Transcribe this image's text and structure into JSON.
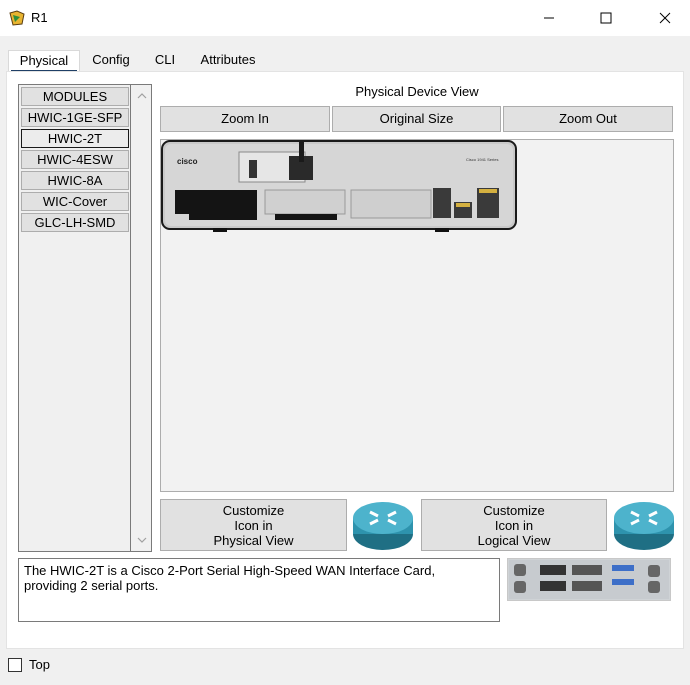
{
  "window": {
    "title": "R1",
    "controls": {
      "minimize": "minimize-icon",
      "maximize": "maximize-icon",
      "close": "close-icon"
    }
  },
  "tabs": [
    {
      "label": "Physical",
      "active": true
    },
    {
      "label": "Config",
      "active": false
    },
    {
      "label": "CLI",
      "active": false
    },
    {
      "label": "Attributes",
      "active": false
    }
  ],
  "modules": {
    "items": [
      "MODULES",
      "HWIC-1GE-SFP",
      "HWIC-2T",
      "HWIC-4ESW",
      "HWIC-8A",
      "WIC-Cover",
      "GLC-LH-SMD"
    ],
    "selected": "HWIC-2T"
  },
  "device_view": {
    "label": "Physical Device View",
    "zoom_in": "Zoom In",
    "original_size": "Original Size",
    "zoom_out": "Zoom Out",
    "brand": "cisco",
    "model": "Cisco 1941 Series"
  },
  "customize": {
    "physical": [
      "Customize",
      "Icon in",
      "Physical View"
    ],
    "logical": [
      "Customize",
      "Icon in",
      "Logical View"
    ]
  },
  "description": {
    "line1": "The HWIC-2T is a Cisco 2-Port Serial High-Speed WAN Interface Card,",
    "line2": "providing 2 serial ports."
  },
  "footer": {
    "top_label": "Top",
    "top_checked": false
  },
  "colors": {
    "accent": "#1f3f66",
    "router_blue": "#2e93ad"
  }
}
